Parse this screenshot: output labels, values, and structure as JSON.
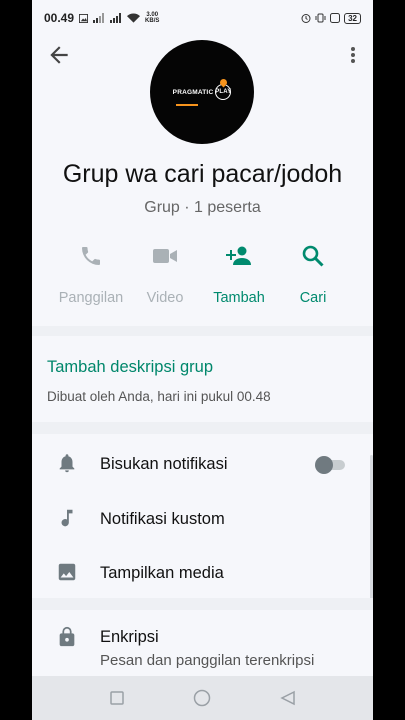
{
  "status_bar": {
    "time": "00.49",
    "speed_value": "3.00",
    "speed_unit": "KB/S",
    "battery": "32"
  },
  "group": {
    "name": "Grup wa cari pacar/jodoh",
    "subtitle": "Grup · 1 peserta",
    "avatar_text": "PRAGMATIC",
    "avatar_text2": "PLAY"
  },
  "actions": [
    {
      "label": "Panggilan",
      "icon": "phone-icon",
      "enabled": false
    },
    {
      "label": "Video",
      "icon": "video-icon",
      "enabled": false
    },
    {
      "label": "Tambah",
      "icon": "add-person-icon",
      "enabled": true
    },
    {
      "label": "Cari",
      "icon": "search-icon",
      "enabled": true
    }
  ],
  "description": {
    "link": "Tambah deskripsi grup",
    "created": "Dibuat oleh Anda, hari ini pukul 00.48"
  },
  "settings": [
    {
      "label": "Bisukan notifikasi",
      "icon": "bell-icon",
      "toggle": false
    },
    {
      "label": "Notifikasi kustom",
      "icon": "music-note-icon"
    },
    {
      "label": "Tampilkan media",
      "icon": "image-icon"
    }
  ],
  "encryption": {
    "title": "Enkripsi",
    "desc": "Pesan dan panggilan terenkripsi"
  },
  "colors": {
    "accent": "#008a6e",
    "disabled": "#aab1b6"
  }
}
